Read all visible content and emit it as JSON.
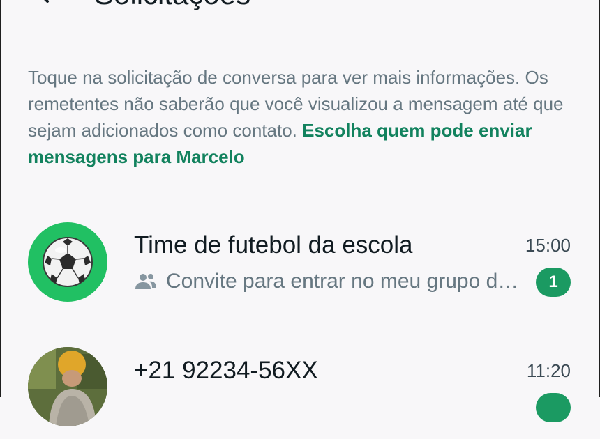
{
  "header": {
    "title": "Solicitações"
  },
  "info": {
    "text": "Toque na solicitação de conversa para ver mais informações. Os remetentes não saberão que você visualizou a mensagem até que sejam adicionados como contato. ",
    "link": "Escolha quem pode enviar mensagens para Marcelo"
  },
  "requests": [
    {
      "name": "Time de futebol da escola",
      "time": "15:00",
      "preview": "Convite para entrar no meu grupo do WhatsApp",
      "unread": "1",
      "avatar": "soccer-ball-icon"
    },
    {
      "name": "+21 92234-56XX",
      "time": "11:20",
      "preview": "",
      "unread": "",
      "avatar": "photo"
    }
  ],
  "colors": {
    "accent": "#12825e",
    "badge": "#1b9a62",
    "avatar_bg": "#21c063",
    "muted_text": "#667781"
  }
}
